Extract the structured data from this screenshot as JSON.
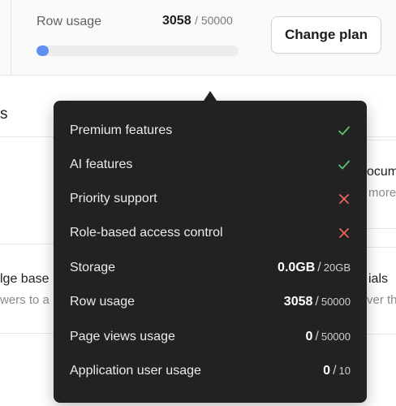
{
  "header": {
    "row_usage_label": "Row usage",
    "row_usage_used": "3058",
    "row_usage_limit": "/ 50000",
    "row_usage_fraction": 0.06116,
    "change_plan_label": "Change plan"
  },
  "background": {
    "heading_fragment": "s",
    "right_title_fragment": "ocum",
    "right_sub_fragment": "more",
    "left_title_fragment": "lge base",
    "left_sub_fragment": "wers to a",
    "right_title2_fragment": "ials",
    "right_sub2_fragment": "ver th"
  },
  "tooltip": {
    "features": [
      {
        "label": "Premium features",
        "status": "check-icon"
      },
      {
        "label": "AI features",
        "status": "check-icon"
      },
      {
        "label": "Priority support",
        "status": "close-icon"
      },
      {
        "label": "Role-based access control",
        "status": "close-icon"
      }
    ],
    "usage": [
      {
        "label": "Storage",
        "used": "0.0GB",
        "limit": "20GB"
      },
      {
        "label": "Row usage",
        "used": "3058",
        "limit": "50000"
      },
      {
        "label": "Page views usage",
        "used": "0",
        "limit": "50000"
      },
      {
        "label": "Application user usage",
        "used": "0",
        "limit": "10"
      }
    ]
  },
  "colors": {
    "check": "#5cc271",
    "cross": "#e8675c",
    "progress": "#5f8ff3",
    "tooltip_bg": "#222222"
  }
}
